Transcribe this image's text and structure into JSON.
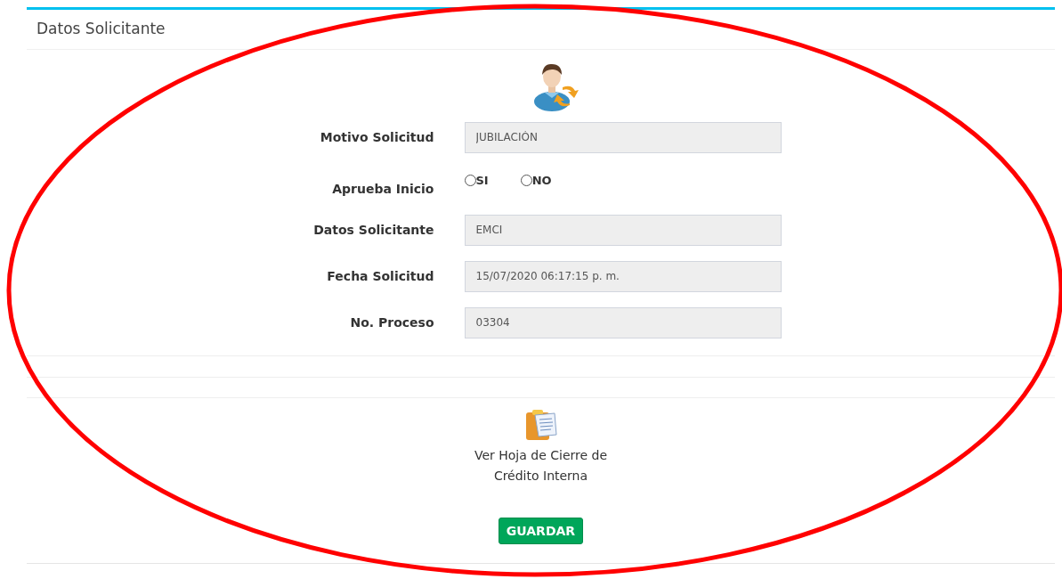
{
  "panel": {
    "title": "Datos Solicitante"
  },
  "fields": [
    {
      "kind": "text",
      "label": "Motivo Solicitud",
      "value": "JUBILACIÓN"
    },
    {
      "kind": "radio",
      "label": "Aprueba Inicio",
      "options": [
        {
          "label": "SI",
          "selected": false
        },
        {
          "label": "NO",
          "selected": false
        }
      ]
    },
    {
      "kind": "text",
      "label": "Datos Solicitante",
      "value": "EMCI"
    },
    {
      "kind": "text",
      "label": "Fecha Solicitud",
      "value": "15/07/2020 06:17:15 p. m."
    },
    {
      "kind": "text",
      "label": "No. Proceso",
      "value": "03304"
    }
  ],
  "document_link": {
    "lines": [
      "Ver Hoja de Cierre de",
      "Crédito Interna"
    ]
  },
  "save_button": {
    "label": "GUARDAR"
  }
}
